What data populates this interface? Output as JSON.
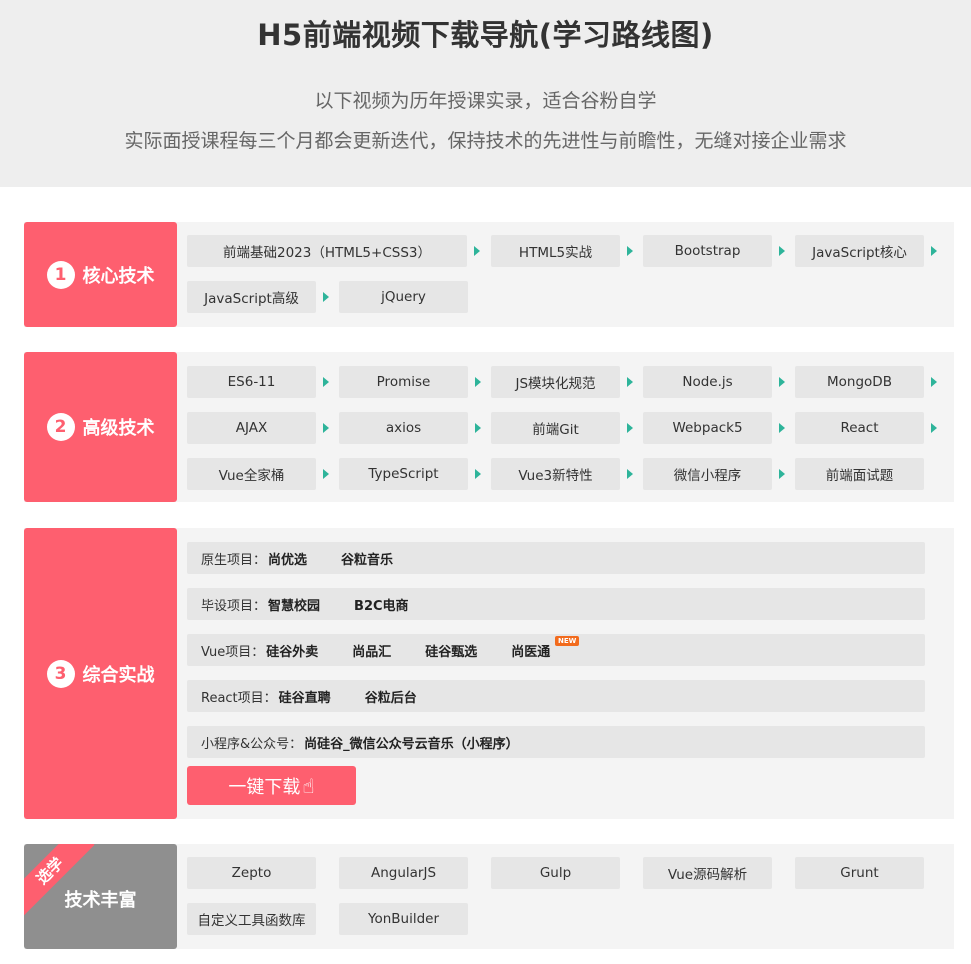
{
  "header": {
    "title": "H5前端视频下载导航(学习路线图)",
    "subtitle1": "以下视频为历年授课实录，适合谷粉自学",
    "subtitle2": "实际面授课程每三个月都会更新迭代，保持技术的先进性与前瞻性，无缝对接企业需求"
  },
  "core": {
    "number": "1",
    "label": "核心技术",
    "items": [
      "前端基础2023（HTML5+CSS3）",
      "HTML5实战",
      "Bootstrap",
      "JavaScript核心",
      "JavaScript高级",
      "jQuery"
    ]
  },
  "advanced": {
    "number": "2",
    "label": "高级技术",
    "items": [
      "ES6-11",
      "Promise",
      "JS模块化规范",
      "Node.js",
      "MongoDB",
      "AJAX",
      "axios",
      "前端Git",
      "Webpack5",
      "React",
      "Vue全家桶",
      "TypeScript",
      "Vue3新特性",
      "微信小程序",
      "前端面试题"
    ]
  },
  "practice": {
    "number": "3",
    "label": "综合实战",
    "rows": [
      {
        "label": "原生项目：",
        "items": [
          "尚优选",
          "谷粒音乐"
        ]
      },
      {
        "label": "毕设项目：",
        "items": [
          "智慧校园",
          "B2C电商"
        ]
      },
      {
        "label": "Vue项目：",
        "items": [
          "硅谷外卖",
          "尚品汇",
          "硅谷甄选",
          "尚医通"
        ],
        "badge": "NEW"
      },
      {
        "label": "React项目：",
        "items": [
          "硅谷直聘",
          "谷粒后台"
        ]
      },
      {
        "label": "小程序&公众号：",
        "items": [
          "尚硅谷_微信公众号云音乐（小程序）"
        ]
      }
    ],
    "download_label": "一键下载",
    "download_icon": "hand-pointer-icon"
  },
  "extra": {
    "ribbon": "选学",
    "label": "技术丰富",
    "items": [
      "Zepto",
      "AngularJS",
      "Gulp",
      "Vue源码解析",
      "Grunt",
      "自定义工具函数库",
      "YonBuilder"
    ]
  },
  "colors": {
    "accent": "#fe5f6f",
    "arrow": "#2eb49a",
    "gray": "#8f8f8f",
    "badge": "#f26b1d"
  }
}
